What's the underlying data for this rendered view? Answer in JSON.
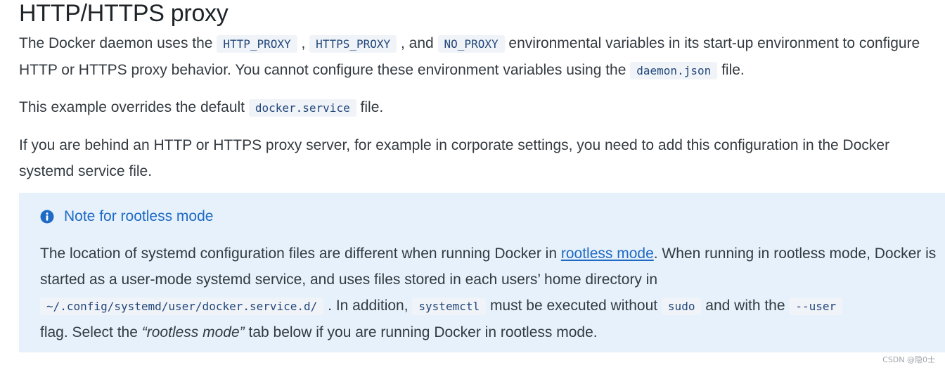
{
  "heading": "HTTP/HTTPS proxy",
  "p1": {
    "t1": "The Docker daemon uses the ",
    "c1": "HTTP_PROXY",
    "t2": " , ",
    "c2": "HTTPS_PROXY",
    "t3": " , and ",
    "c3": "NO_PROXY",
    "t4": " environmental variables in its start-up environment to configure HTTP or HTTPS proxy behavior. You cannot configure these environment variables using the ",
    "c4": "daemon.json",
    "t5": " file."
  },
  "p2": {
    "t1": "This example overrides the default ",
    "c1": "docker.service",
    "t2": " file."
  },
  "p3": {
    "text": "If you are behind an HTTP or HTTPS proxy server, for example in corporate settings, you need to add this configuration in the Docker systemd service file."
  },
  "note": {
    "title": "Note for rootless mode",
    "icon": "info-icon",
    "accent_color": "#1f6ac4",
    "background_color": "#e6f1fb",
    "t1": "The location of systemd configuration files are different when running Docker in ",
    "link": "rootless mode",
    "t2": ". When running in rootless mode, Docker is started as a user-mode systemd service, and uses files stored in each users’ home directory in ",
    "c1": "~/.config/systemd/user/docker.service.d/",
    "t3": " . In addition, ",
    "c2": "systemctl",
    "t4": " must be executed without ",
    "c3": "sudo",
    "t5": " and with the ",
    "c4": "--user",
    "t6": " flag. Select the ",
    "em": "“rootless mode”",
    "t7": " tab below if you are running Docker in rootless mode."
  },
  "watermark": "CSDN @隐0士"
}
